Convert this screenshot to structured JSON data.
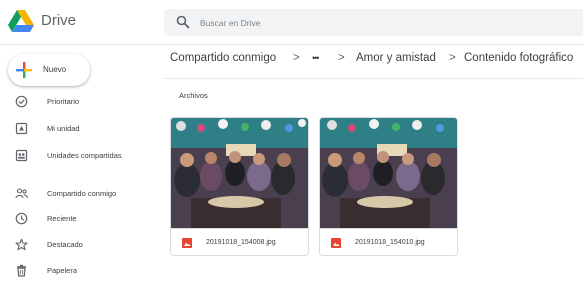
{
  "app": {
    "brand": "Drive",
    "search_placeholder": "Buscar en Drive"
  },
  "new_button": {
    "label": "Nuevo"
  },
  "sidebar": {
    "items": [
      {
        "label": "Prioritario",
        "icon": "priority-icon"
      },
      {
        "label": "Mi unidad",
        "icon": "my-drive-icon"
      },
      {
        "label": "Unidades compartidas",
        "icon": "shared-drives-icon"
      },
      {
        "label": "Compartido conmigo",
        "icon": "shared-with-me-icon"
      },
      {
        "label": "Reciente",
        "icon": "clock-icon"
      },
      {
        "label": "Destacado",
        "icon": "star-icon"
      },
      {
        "label": "Papelera",
        "icon": "trash-icon"
      }
    ]
  },
  "breadcrumb": {
    "items": [
      "Compartido conmigo",
      "•••",
      "Amor y amistad",
      "Contenido fotográfico"
    ],
    "separator": ">"
  },
  "main": {
    "section_title": "Archivos",
    "files": [
      {
        "name": "20191018_154008.jpg",
        "type": "image-file-icon"
      },
      {
        "name": "20191018_154010.jpg",
        "type": "image-file-icon"
      }
    ]
  },
  "colors": {
    "accent_red": "#ea4335",
    "drive_green": "#0f9d58",
    "drive_yellow": "#f4b400",
    "drive_blue": "#4285f4"
  }
}
